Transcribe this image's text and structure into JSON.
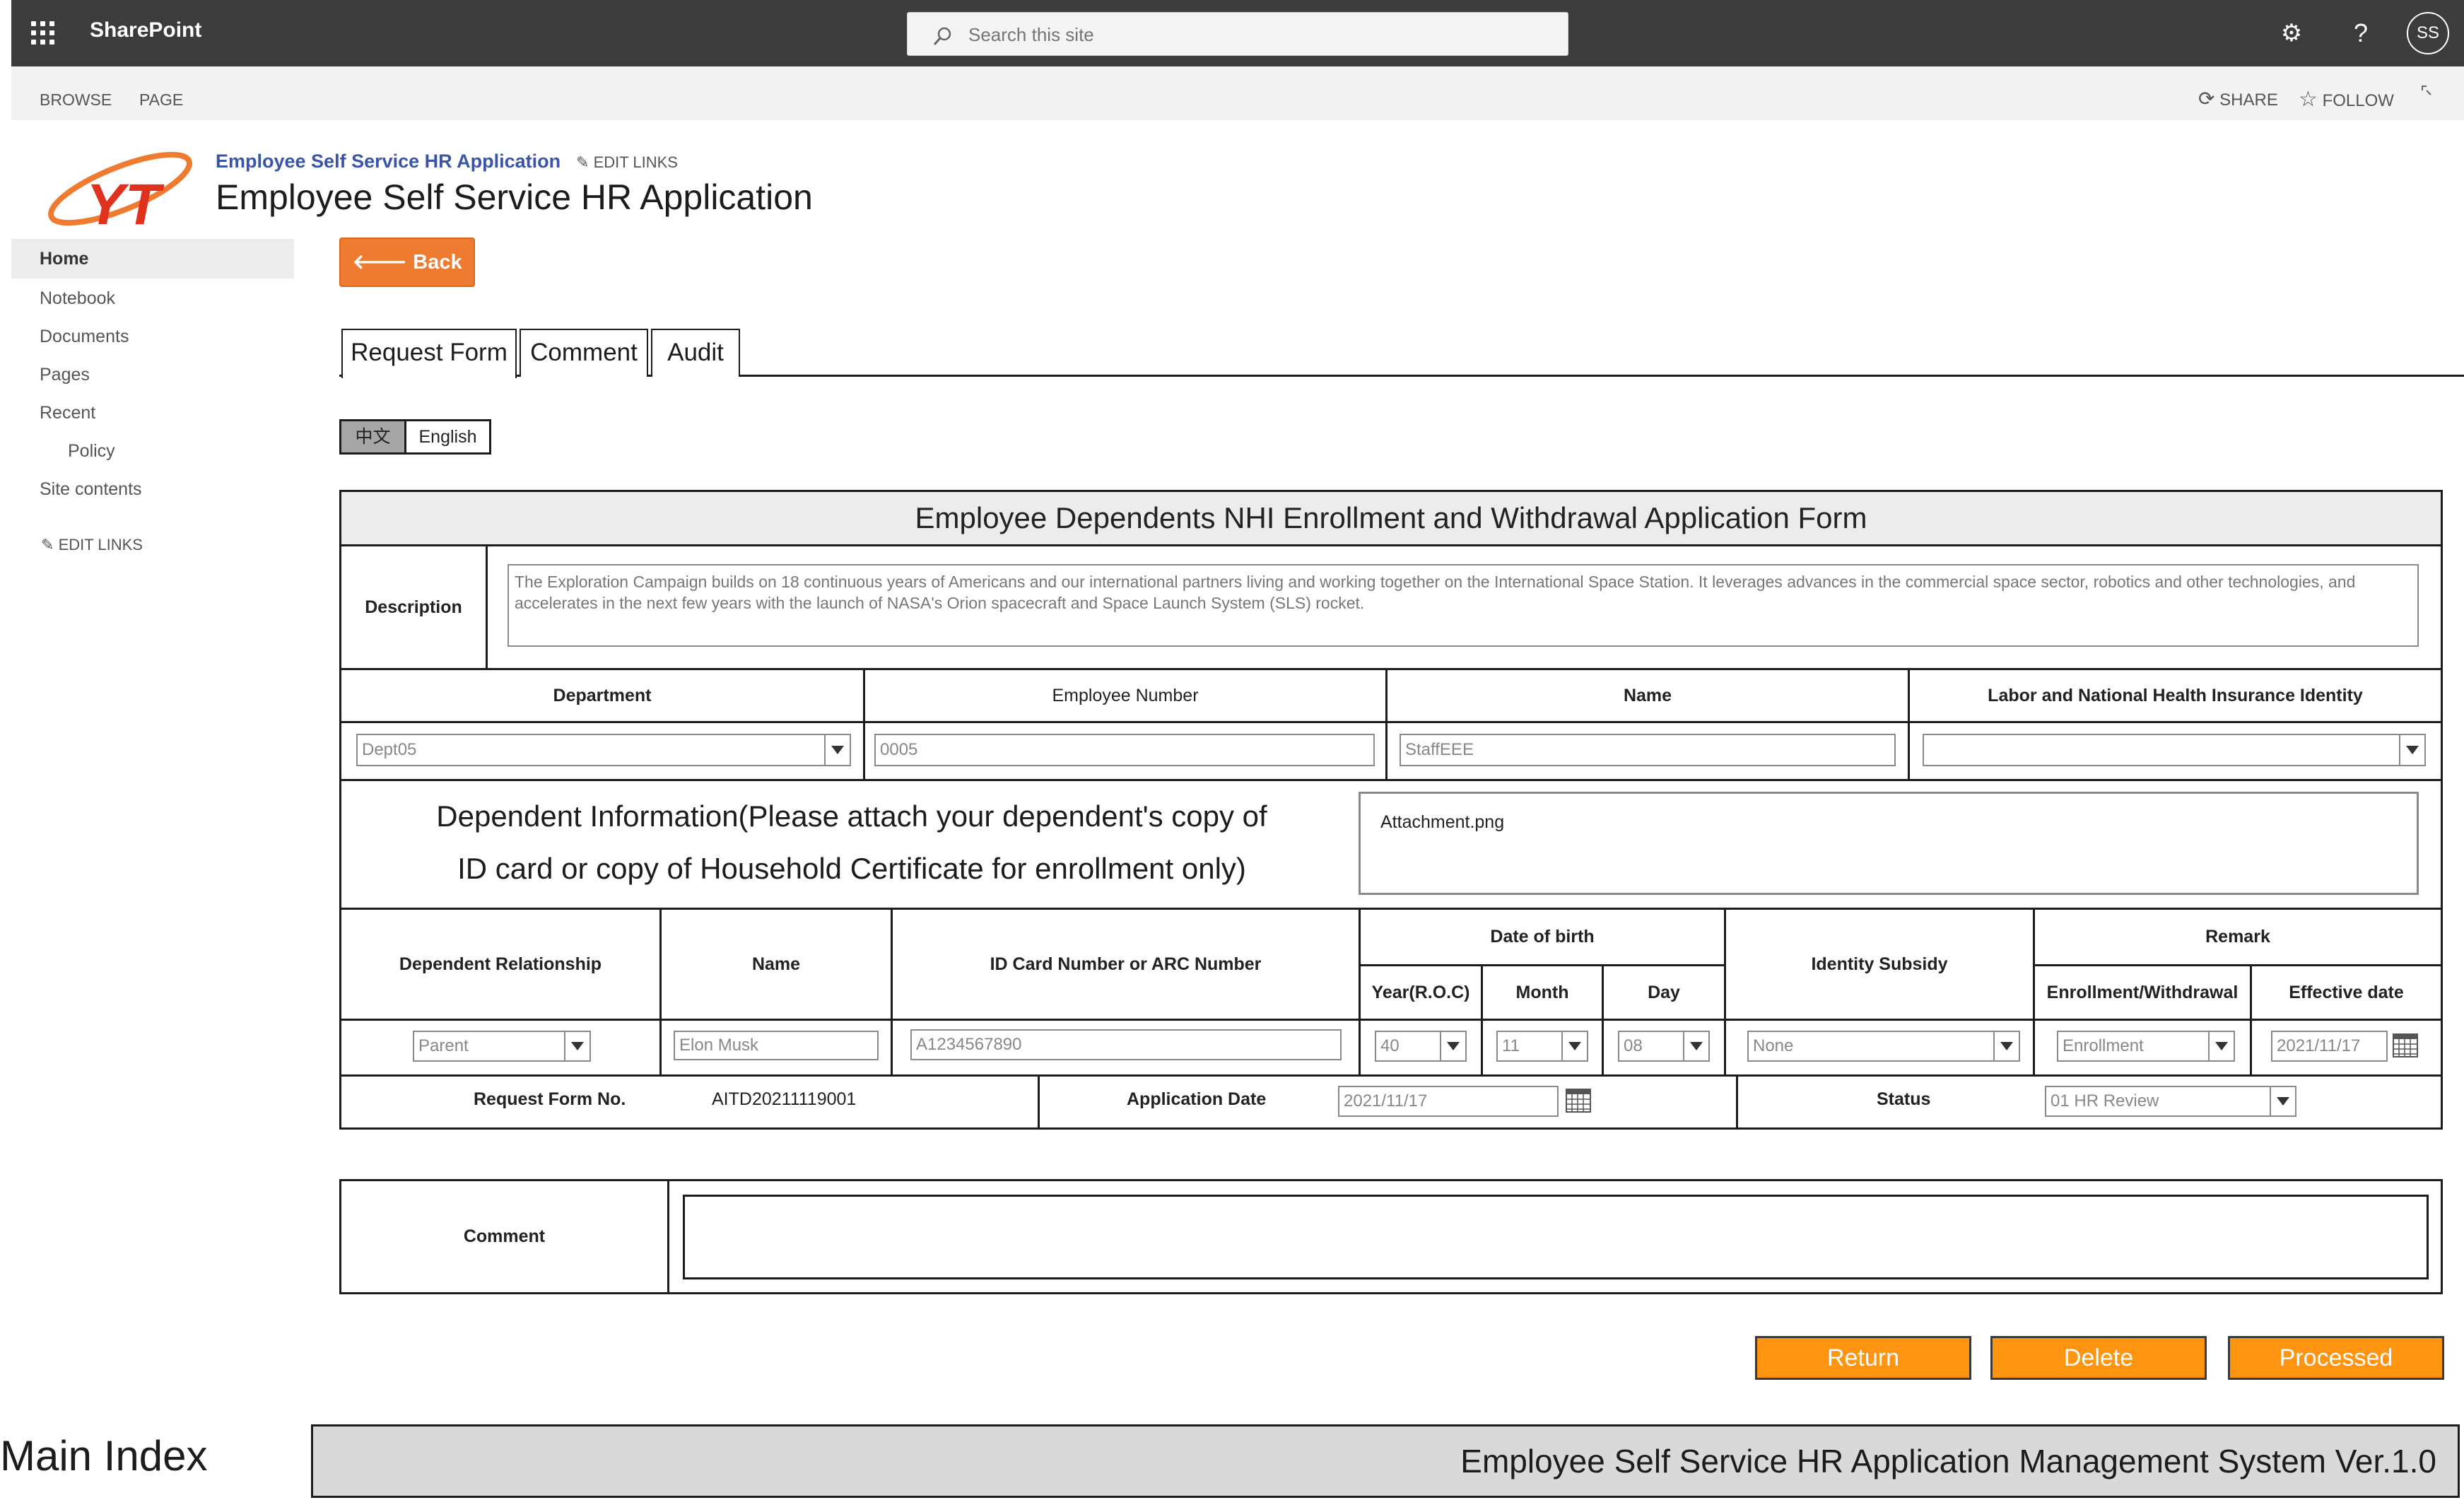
{
  "topbar": {
    "brand": "SharePoint",
    "search_placeholder": "Search this site",
    "avatar_initials": "SS"
  },
  "ribbon": {
    "browse": "BROWSE",
    "page": "PAGE",
    "share": "SHARE",
    "follow": "FOLLOW"
  },
  "site": {
    "small_title": "Employee Self Service HR Application",
    "edit_links": "EDIT LINKS",
    "title": "Employee Self Service HR Application",
    "logo_text": "YT"
  },
  "nav": {
    "items": [
      "Home",
      "Notebook",
      "Documents",
      "Pages",
      "Recent",
      "Policy",
      "Site contents"
    ],
    "edit_links": "EDIT LINKS"
  },
  "back_label": "Back",
  "tabs": [
    "Request Form",
    "Comment",
    "Audit"
  ],
  "language": {
    "zh": "中文",
    "en": "English"
  },
  "form": {
    "title": "Employee Dependents NHI Enrollment and Withdrawal Application Form",
    "description_label": "Description",
    "description_text": "The Exploration Campaign builds on 18 continuous years of Americans and our international partners living and working together on the International Space Station. It leverages advances in the commercial space sector, robotics and other technologies, and accelerates in the next few years with the launch of NASA's Orion spacecraft and Space Launch System (SLS) rocket.",
    "headers": {
      "department": "Department",
      "employee_number": "Employee Number",
      "name": "Name",
      "insurance_identity": "Labor and National Health Insurance Identity"
    },
    "values": {
      "department": "Dept05",
      "employee_number": "0005",
      "name": "StaffEEE",
      "insurance_identity": ""
    },
    "dependent_info_line1": "Dependent Information(Please attach your dependent's copy of",
    "dependent_info_line2": "ID card or copy of Household Certificate for enrollment only)",
    "attachment": "Attachment.png",
    "dep_headers": {
      "relationship": "Dependent Relationship",
      "name": "Name",
      "id_card": "ID Card Number or ARC Number",
      "dob": "Date of birth",
      "year": "Year(R.O.C)",
      "month": "Month",
      "day": "Day",
      "subsidy": "Identity Subsidy",
      "remark": "Remark",
      "enroll": "Enrollment/Withdrawal",
      "effective": "Effective date"
    },
    "dep_values": {
      "relationship": "Parent",
      "name": "Elon Musk",
      "id_card": "A1234567890",
      "year": "40",
      "month": "11",
      "day": "08",
      "subsidy": "None",
      "enroll": "Enrollment",
      "effective": "2021/11/17"
    },
    "request_no_label": "Request Form No.",
    "request_no": "AITD20211119001",
    "application_date_label": "Application Date",
    "application_date": "2021/11/17",
    "status_label": "Status",
    "status": "01 HR Review",
    "comment_label": "Comment",
    "comment": ""
  },
  "actions": {
    "return": "Return",
    "delete": "Delete",
    "processed": "Processed"
  },
  "footer": {
    "main_index": "Main Index",
    "system": "Employee Self Service HR Application Management System Ver.1.0"
  },
  "colors": {
    "topbar": "#3c3c3c",
    "back_button": "#ef7b30",
    "action_button": "#ff9410",
    "link": "#3a55a8"
  }
}
